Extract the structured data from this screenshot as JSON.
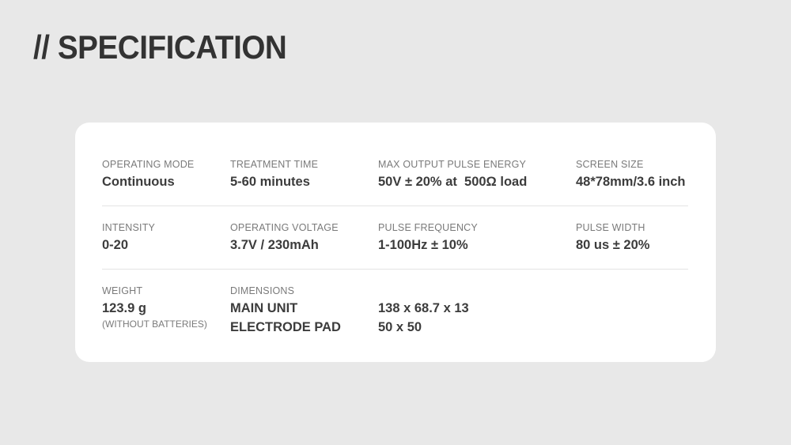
{
  "title": "// SPECIFICATION",
  "specs": {
    "operating_mode": {
      "label": "OPERATING MODE",
      "value": "Continuous"
    },
    "treatment_time": {
      "label": "TREATMENT TIME",
      "value": "5-60 minutes"
    },
    "max_output_pulse_energy": {
      "label": "MAX OUTPUT PULSE ENERGY",
      "value": "50V ± 20% at  500Ω load"
    },
    "screen_size": {
      "label": "SCREEN SIZE",
      "value": "48*78mm/3.6 inch"
    },
    "intensity": {
      "label": "INTENSITY",
      "value": "0-20"
    },
    "operating_voltage": {
      "label": "OPERATING VOLTAGE",
      "value": "3.7V / 230mAh"
    },
    "pulse_frequency": {
      "label": "PULSE FREQUENCY",
      "value": "1-100Hz ± 10%"
    },
    "pulse_width": {
      "label": "PULSE WIDTH",
      "value": "80 us ± 20%"
    },
    "weight": {
      "label": "WEIGHT",
      "value": "123.9 g",
      "note": "(WITHOUT BATTERIES)"
    },
    "dimensions": {
      "label": "DIMENSIONS",
      "items": [
        {
          "name": "MAIN UNIT",
          "value": "138 x 68.7 x 13"
        },
        {
          "name": "ELECTRODE PAD",
          "value": "50 x 50"
        }
      ]
    }
  }
}
